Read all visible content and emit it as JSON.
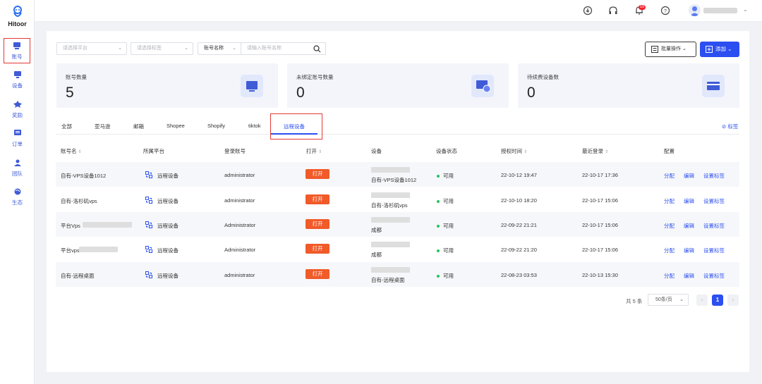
{
  "app": {
    "name": "Hitoor"
  },
  "nav": [
    {
      "label": "账号",
      "icon": "account-icon"
    },
    {
      "label": "设备",
      "icon": "device-icon"
    },
    {
      "label": "奖励",
      "icon": "reward-icon"
    },
    {
      "label": "订单",
      "icon": "order-icon"
    },
    {
      "label": "团队",
      "icon": "team-icon"
    },
    {
      "label": "生态",
      "icon": "ecosystem-icon"
    }
  ],
  "topbar": {
    "notification_count": "10"
  },
  "filters": {
    "platform_placeholder": "请选择平台",
    "tag_placeholder": "请选择标签",
    "field_select": "账号名称",
    "search_placeholder": "请输入账号名称"
  },
  "actions": {
    "batch": "批量操作",
    "add": "添加"
  },
  "stats": [
    {
      "label": "账号数量",
      "value": "5"
    },
    {
      "label": "未绑定账号数量",
      "value": "0"
    },
    {
      "label": "待续费设备数",
      "value": "0"
    }
  ],
  "tabs": [
    "全部",
    "亚马逊",
    "邮箱",
    "Shopee",
    "Shopify",
    "tiktok",
    "远程设备"
  ],
  "tag_link": "标签",
  "columns": [
    "账号名",
    "所属平台",
    "登录账号",
    "打开",
    "设备",
    "设备状态",
    "授权时间",
    "最近登录",
    "配置"
  ],
  "rows": [
    {
      "name": "自有-VPS设备1012",
      "platform": "远程设备",
      "login": "administrator",
      "open": "打开",
      "device": "自有-VPS设备1012",
      "status": "可用",
      "auth": "22-10-12 19:47",
      "last": "22-10-17 17:36",
      "ops": [
        "分配",
        "编辑",
        "设置标签"
      ]
    },
    {
      "name": "自有-洛杉矶vps",
      "platform": "远程设备",
      "login": "administrator",
      "open": "打开",
      "device": "自有-洛杉矶vps",
      "status": "可用",
      "auth": "22-10-10 18:20",
      "last": "22-10-17 15:06",
      "ops": [
        "分配",
        "编辑",
        "设置标签"
      ]
    },
    {
      "name": "平台Vps",
      "platform": "远程设备",
      "login": "Administrator",
      "open": "打开",
      "device": "成都",
      "status": "可用",
      "auth": "22-09-22 21:21",
      "last": "22-10-17 15:06",
      "ops": [
        "分配",
        "编辑",
        "设置标签"
      ]
    },
    {
      "name": "平台vps",
      "platform": "远程设备",
      "login": "Administrator",
      "open": "打开",
      "device": "成都",
      "status": "可用",
      "auth": "22-09-22 21:20",
      "last": "22-10-17 15:06",
      "ops": [
        "分配",
        "编辑",
        "设置标签"
      ]
    },
    {
      "name": "自有-远程桌面",
      "platform": "远程设备",
      "login": "administrator",
      "open": "打开",
      "device": "自有-远程桌面",
      "status": "可用",
      "auth": "22-08-23 03:53",
      "last": "22-10-13 15:30",
      "ops": [
        "分配",
        "编辑",
        "设置标签"
      ]
    }
  ],
  "pagination": {
    "total": "共 5 条",
    "page_size": "50条/页",
    "current": "1"
  },
  "colors": {
    "primary": "#2b4ff0",
    "open_button": "#f15a29",
    "status_ok": "#22c55e",
    "highlight_box": "#e53935"
  }
}
